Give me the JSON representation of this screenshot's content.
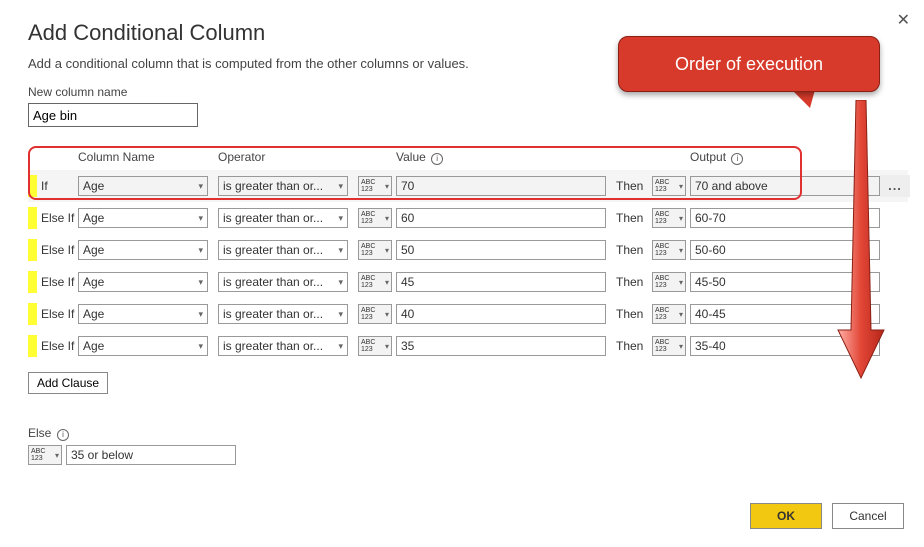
{
  "title": "Add Conditional Column",
  "subtitle": "Add a conditional column that is computed from the other columns or values.",
  "newColumnLabel": "New column name",
  "newColumnValue": "Age bin",
  "headers": {
    "columnName": "Column Name",
    "operator": "Operator",
    "value": "Value",
    "output": "Output"
  },
  "thenLabel": "Then",
  "rules": [
    {
      "kw": "If",
      "column": "Age",
      "operator": "is greater than or...",
      "value": "70",
      "output": "70 and above"
    },
    {
      "kw": "Else If",
      "column": "Age",
      "operator": "is greater than or...",
      "value": "60",
      "output": "60-70"
    },
    {
      "kw": "Else If",
      "column": "Age",
      "operator": "is greater than or...",
      "value": "50",
      "output": "50-60"
    },
    {
      "kw": "Else If",
      "column": "Age",
      "operator": "is greater than or...",
      "value": "45",
      "output": "45-50"
    },
    {
      "kw": "Else If",
      "column": "Age",
      "operator": "is greater than or...",
      "value": "40",
      "output": "40-45"
    },
    {
      "kw": "Else If",
      "column": "Age",
      "operator": "is greater than or...",
      "value": "35",
      "output": "35-40"
    }
  ],
  "addClauseLabel": "Add Clause",
  "elseLabel": "Else",
  "elseValue": "35 or below",
  "okLabel": "OK",
  "cancelLabel": "Cancel",
  "callout": "Order of execution",
  "moreDots": "...",
  "abc": "ABC",
  "n123": "123"
}
